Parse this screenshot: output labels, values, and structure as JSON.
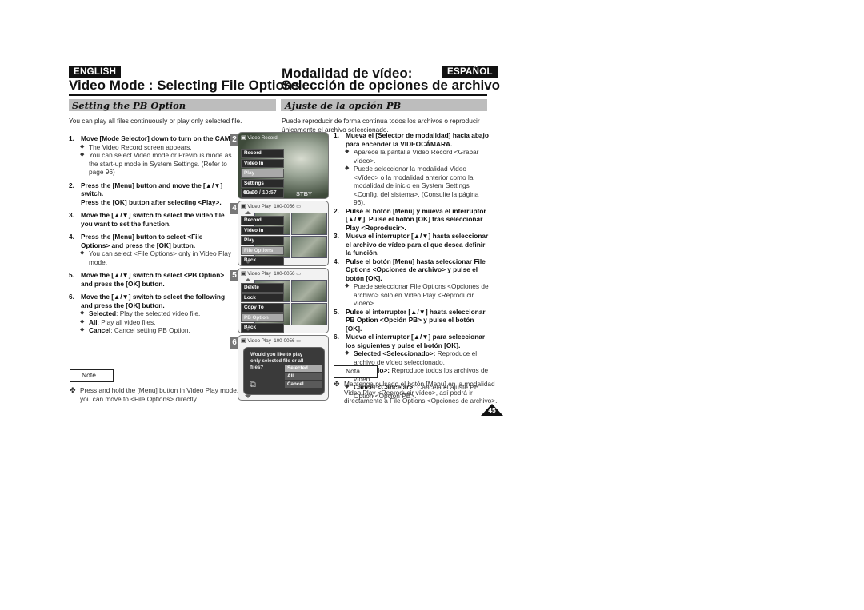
{
  "english": {
    "lang_label": "ENGLISH",
    "title": "Video Mode : Selecting File Options",
    "section_title": "Setting the PB Option",
    "intro": "You can play all files continuously or play only selected file.",
    "steps": [
      {
        "num": "1.",
        "text": "Move [Mode Selector] down to turn on the CAM.",
        "bullets": [
          {
            "text": "The Video Record screen appears."
          },
          {
            "text": "You can select Video mode or Previous mode as the start-up mode in System Settings. (Refer to page 96)"
          }
        ]
      },
      {
        "num": "2.",
        "text": "Press the [Menu] button and move the [▲/▼] switch.",
        "text2": "Press the [OK] button after selecting <Play>.",
        "bullets": []
      },
      {
        "num": "3.",
        "text": "Move the [▲/▼] switch to select the video file you want to set the function.",
        "bullets": []
      },
      {
        "num": "4.",
        "text": "Press the [Menu] button to select <File Options> and press the [OK] button.",
        "bullets": [
          {
            "text": "You can select <File Options> only in Video Play mode."
          }
        ]
      },
      {
        "num": "5.",
        "text": "Move the [▲/▼] switch to select <PB Option> and press the [OK] button.",
        "bullets": []
      },
      {
        "num": "6.",
        "text": "Move the [▲/▼] switch to select the following and press the [OK] button.",
        "bullets": [
          {
            "term": "Selected",
            "text": ": Play the selected video file."
          },
          {
            "term": "All",
            "text": ": Play all video files."
          },
          {
            "term": "Cancel",
            "text": ": Cancel setting PB Option."
          }
        ]
      }
    ],
    "note_label": "Note",
    "note_text": "Press and hold the [Menu] button in Video Play mode, you can move to <File Options> directly."
  },
  "spanish": {
    "lang_label": "ESPAÑOL",
    "title_line1": "Modalidad de vídeo:",
    "title_line2": "Selección de opciones de archivo",
    "section_title": "Ajuste de la opción PB",
    "intro": "Puede reproducir de forma continua todos los archivos o reproducir únicamente el archivo seleccionado.",
    "steps": [
      {
        "num": "1.",
        "text": "Mueva el [Selector de modalidad] hacia abajo para encender la VIDEOCÁMARA.",
        "bullets": [
          {
            "text": "Aparece la pantalla Video Record <Grabar vídeo>."
          },
          {
            "text": "Puede seleccionar la modalidad Video <Vídeo> o la modalidad anterior como la modalidad de inicio en System Settings <Config. del sistema>. (Consulte la página 96)."
          }
        ]
      },
      {
        "num": "2.",
        "text": "Pulse el botón [Menu] y mueva el interruptor [▲/▼]. Pulse el botón [OK] tras seleccionar Play <Reproducir>.",
        "bullets": []
      },
      {
        "num": "3.",
        "text": "Mueva el interruptor [▲/▼] hasta seleccionar el archivo de vídeo para el que desea definir la función.",
        "bullets": []
      },
      {
        "num": "4.",
        "text": "Pulse el botón [Menu] hasta seleccionar File Options <Opciones de archivo> y pulse el botón [OK].",
        "bullets": [
          {
            "text": "Puede seleccionar File Options <Opciones de archivo> sólo en Video Play <Reproducir vídeo>."
          }
        ]
      },
      {
        "num": "5.",
        "text": "Pulse el interruptor [▲/▼] hasta seleccionar PB Option <Opción PB> y pulse el botón [OK].",
        "bullets": []
      },
      {
        "num": "6.",
        "text": "Mueva el interruptor [▲/▼] para seleccionar los siguientes y pulse el botón [OK].",
        "bullets": [
          {
            "term": "Selected <Seleccionado>:",
            "text": " Reproduce el archivo de vídeo seleccionado."
          },
          {
            "term": "All <Todo>:",
            "text": " Reproduce todos los archivos de vídeo."
          },
          {
            "term": "Cancel <Cancelar>:",
            "text": " Cancela el ajuste PB Option <Opción PB>."
          }
        ]
      }
    ],
    "note_label": "Nota",
    "note_text": "Mantenga pulsado el botón [Menu] en la modalidad Video Play <Reproducir vídeo>, así podrá ir directamente a File Options <Opciones de archivo>."
  },
  "screens": [
    {
      "step": "2",
      "header": "Video Record",
      "menu": [
        "Record",
        "Video In",
        "Play",
        "Settings",
        "Back"
      ],
      "selected": 2,
      "footer": "00:00 / 10:57",
      "status": "STBY"
    },
    {
      "step": "4",
      "header": "Video Play",
      "file": "100-0056",
      "menu": [
        "Record",
        "Video In",
        "Play",
        "File Options",
        "Back"
      ],
      "selected": 3
    },
    {
      "step": "5",
      "header": "Video Play",
      "file": "100-0056",
      "menu": [
        "Delete",
        "Lock",
        "Copy To",
        "PB Option",
        "Back"
      ],
      "selected": 3
    },
    {
      "step": "6",
      "header": "Video Play",
      "file": "100-0056",
      "dialog": "Would you like to play only selected file or all files?",
      "options": [
        "Selected",
        "All",
        "Cancel"
      ],
      "selected": 0
    }
  ],
  "page_number": "45",
  "icons": {
    "bullet": "◆",
    "note_symbol": "✤",
    "camera": "🎥"
  }
}
